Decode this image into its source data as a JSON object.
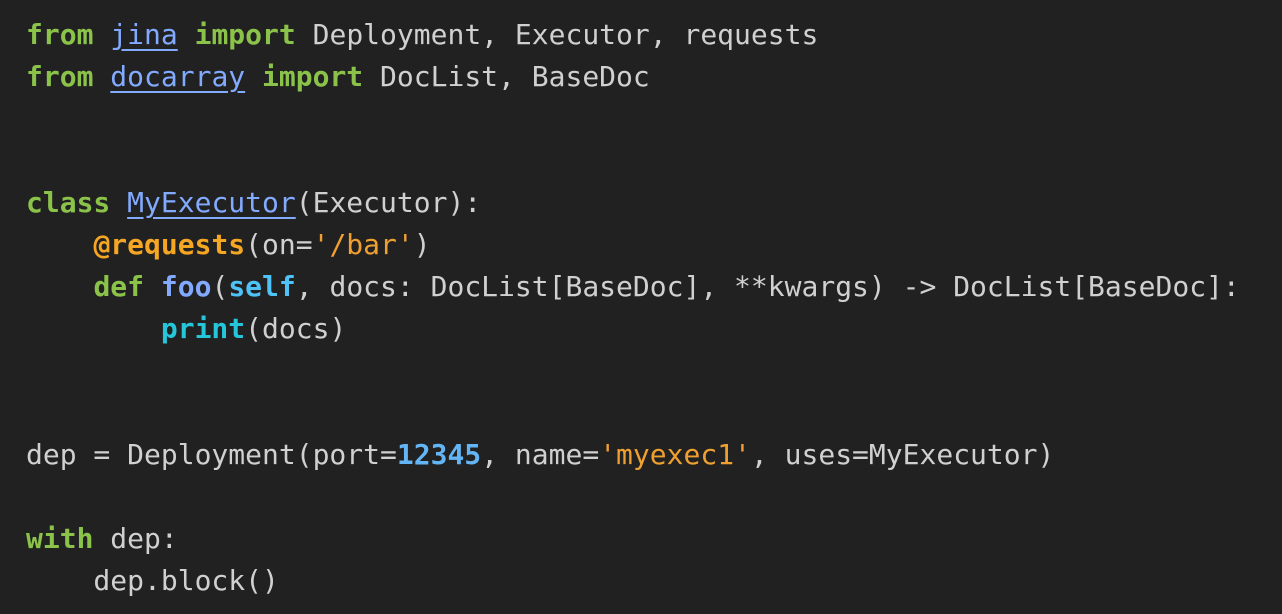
{
  "lines": [
    [
      {
        "t": "kw",
        "v": "from"
      },
      {
        "t": "plain",
        "v": " "
      },
      {
        "t": "mod",
        "v": "jina"
      },
      {
        "t": "plain",
        "v": " "
      },
      {
        "t": "kw",
        "v": "import"
      },
      {
        "t": "plain",
        "v": " Deployment, Executor, requests"
      }
    ],
    [
      {
        "t": "kw",
        "v": "from"
      },
      {
        "t": "plain",
        "v": " "
      },
      {
        "t": "mod",
        "v": "docarray"
      },
      {
        "t": "plain",
        "v": " "
      },
      {
        "t": "kw",
        "v": "import"
      },
      {
        "t": "plain",
        "v": " DocList, BaseDoc"
      }
    ],
    [],
    [],
    [
      {
        "t": "kw",
        "v": "class"
      },
      {
        "t": "plain",
        "v": " "
      },
      {
        "t": "cls",
        "v": "MyExecutor"
      },
      {
        "t": "plain",
        "v": "(Executor):"
      }
    ],
    [
      {
        "t": "plain",
        "v": "    "
      },
      {
        "t": "dec",
        "v": "@requests"
      },
      {
        "t": "plain",
        "v": "(on="
      },
      {
        "t": "str",
        "v": "'/bar'"
      },
      {
        "t": "plain",
        "v": ")"
      }
    ],
    [
      {
        "t": "plain",
        "v": "    "
      },
      {
        "t": "kw",
        "v": "def"
      },
      {
        "t": "plain",
        "v": " "
      },
      {
        "t": "fn",
        "v": "foo"
      },
      {
        "t": "plain",
        "v": "("
      },
      {
        "t": "self",
        "v": "self"
      },
      {
        "t": "plain",
        "v": ", docs: DocList[BaseDoc], **kwargs) -> DocList[BaseDoc]:"
      }
    ],
    [
      {
        "t": "plain",
        "v": "        "
      },
      {
        "t": "builtin",
        "v": "print"
      },
      {
        "t": "plain",
        "v": "(docs)"
      }
    ],
    [],
    [],
    [
      {
        "t": "plain",
        "v": "dep = Deployment(port="
      },
      {
        "t": "num",
        "v": "12345"
      },
      {
        "t": "plain",
        "v": ", name="
      },
      {
        "t": "str",
        "v": "'myexec1'"
      },
      {
        "t": "plain",
        "v": ", uses=MyExecutor)"
      }
    ],
    [],
    [
      {
        "t": "kw",
        "v": "with"
      },
      {
        "t": "plain",
        "v": " dep:"
      }
    ],
    [
      {
        "t": "plain",
        "v": "    dep.block()"
      }
    ]
  ]
}
